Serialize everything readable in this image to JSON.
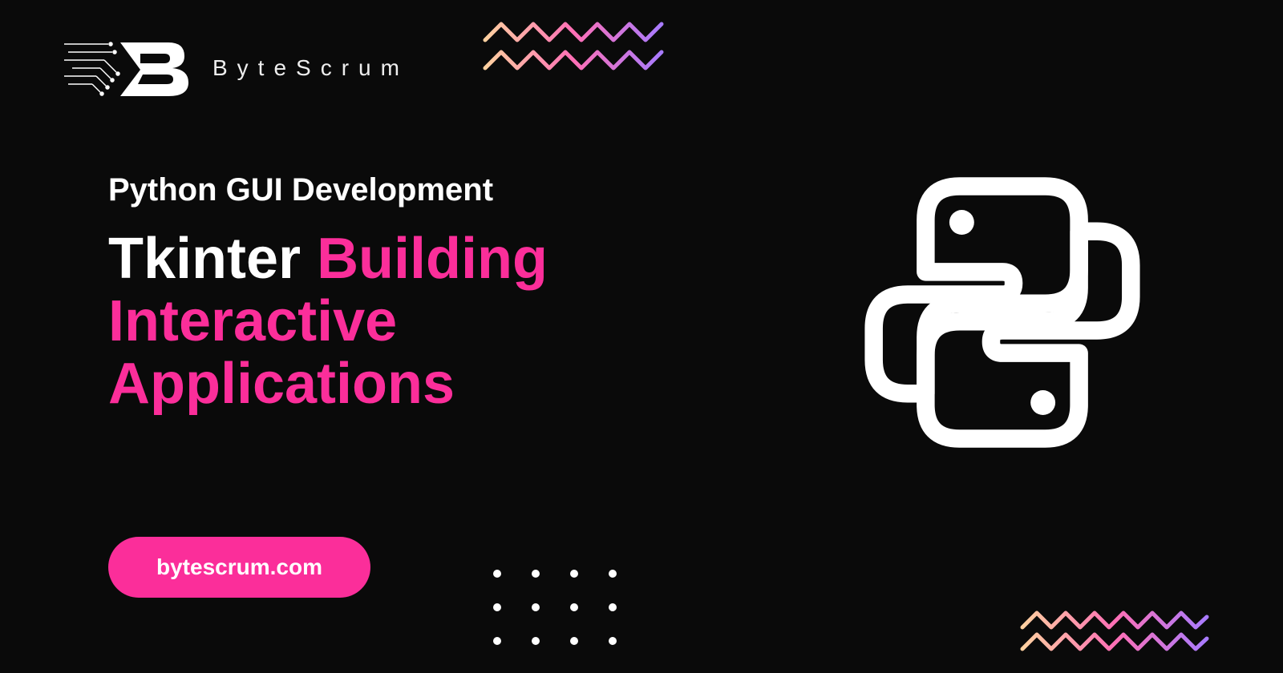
{
  "brand": {
    "name": "ByteScrum"
  },
  "hero": {
    "subtitle": "Python GUI Development",
    "title_white": "Tkinter",
    "title_pink1": "Building",
    "title_pink2": "Interactive",
    "title_pink3": "Applications"
  },
  "cta": {
    "label": "bytescrum.com"
  },
  "colors": {
    "accent": "#fb2e9a",
    "background": "#0a0a0a"
  },
  "icons": {
    "logo": "bytescrum-logo",
    "language": "python-icon",
    "decoration_top": "zigzag-gradient",
    "decoration_bottom": "zigzag-gradient",
    "dots": "dot-grid"
  }
}
